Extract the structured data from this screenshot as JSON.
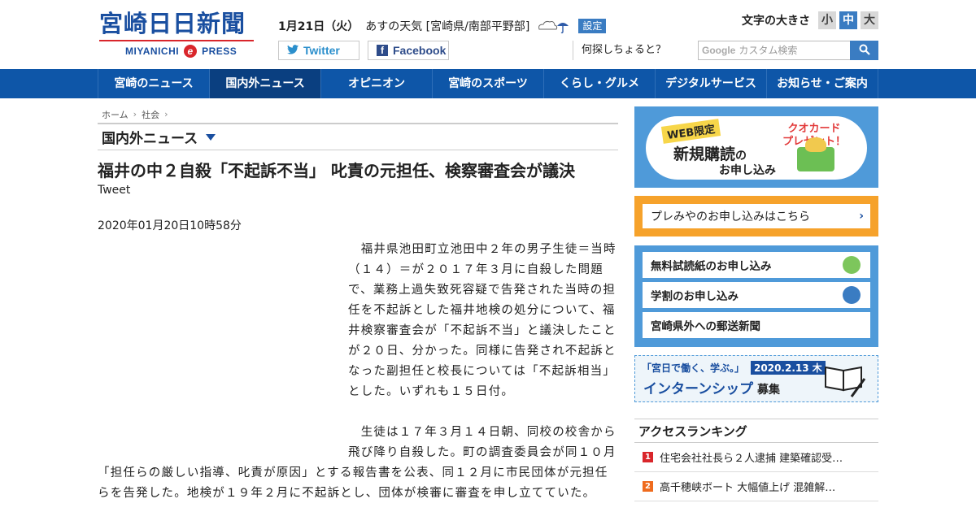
{
  "header": {
    "logo_jp": "宮崎日日新聞",
    "logo_en_left": "MIYANICHI",
    "logo_en_mid": "e",
    "logo_en_right": "PRESS",
    "date": "1月21日（火）",
    "weather_text": "あすの天気 [宮崎県/南部平野部]",
    "settings_label": "設定",
    "twitter_label": "Twitter",
    "facebook_label": "Facebook",
    "fontsize_label": "文字の大きさ",
    "fontsize_small": "小",
    "fontsize_mid": "中",
    "fontsize_large": "大",
    "search_hint": "何探しちょると？",
    "search_google": "Google",
    "search_placeholder": "カスタム検索"
  },
  "nav": {
    "items": [
      {
        "label": "宮崎のニュース"
      },
      {
        "label": "国内外ニュース"
      },
      {
        "label": "オピニオン"
      },
      {
        "label": "宮崎のスポーツ"
      },
      {
        "label": "くらし・グルメ"
      },
      {
        "label": "デジタルサービス"
      },
      {
        "label": "お知らせ・ご案内"
      }
    ]
  },
  "breadcrumb": {
    "home": "ホーム",
    "cat": "社会"
  },
  "section_title": "国内外ニュース",
  "article": {
    "headline": "福井の中２自殺「不起訴不当」 叱責の元担任、検察審査会が議決",
    "tweet_label": "Tweet",
    "pubdate": "2020年01月20日10時58分",
    "para1": "　福井県池田町立池田中２年の男子生徒＝当時（１４）＝が２０１７年３月に自殺した問題で、業務上過失致死容疑で告発された当時の担任を不起訴とした福井地検の処分について、福井検察審査会が「不起訴不当」と議決したことが２０日、分かった。同様に告発され不起訴となった副担任と校長については「不起訴相当」とした。いずれも１５日付。",
    "para2": "　生徒は１７年３月１４日朝、同校の校舎から飛び降り自殺した。町の調査委員会が同１０月「担任らの厳しい指導、叱責が原因」とする報告書を公表、同１２月に市民団体が元担任らを告発した。地検が１９年２月に不起訴とし、団体が検審に審査を申し立てていた。"
  },
  "side": {
    "sub_badge": "WEB限定",
    "sub_main": "新規購読",
    "sub_no": "の",
    "sub_line2": "お申し込み",
    "sub_quo_1": "クオカード",
    "sub_quo_2": "プレゼント！",
    "premi_label": "プレみやのお申し込みはこちら",
    "group_items": [
      {
        "label": "無料試読紙のお申し込み"
      },
      {
        "label": "学割のお申し込み"
      },
      {
        "label": "宮崎県外への郵送新聞"
      }
    ],
    "intern_top": "「宮日で働く、学ぶ。」",
    "intern_date": "2020.2.13 木",
    "intern_main": "インターンシップ",
    "intern_suffix": " 募集",
    "rank_title": "アクセスランキング",
    "ranks": [
      {
        "num": "1",
        "text": "住宅会社社長ら２人逮捕 建築確認受…"
      },
      {
        "num": "2",
        "text": "高千穂峡ボート 大幅値上げ 混雑解…"
      }
    ]
  }
}
